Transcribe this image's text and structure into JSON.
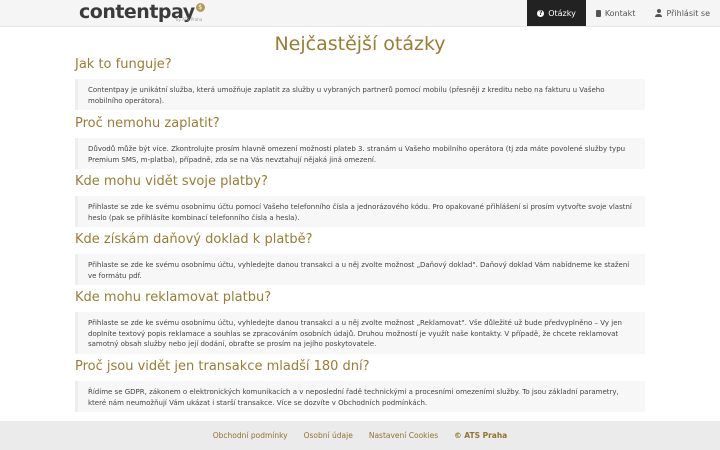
{
  "header": {
    "logo_text_main": "content",
    "logo_text_pay": "pay",
    "logo_sub": "by ATS Praha",
    "nav": [
      {
        "label": "Otázky",
        "icon": "question-icon",
        "active": true
      },
      {
        "label": "Kontakt",
        "icon": "book-icon",
        "active": false
      },
      {
        "label": "Přihlásit se",
        "icon": "user-icon",
        "active": false
      }
    ]
  },
  "main": {
    "title": "Nejčastější otázky",
    "faq": [
      {
        "question": "Jak to funguje?",
        "answer": "Contentpay je unikátní služba, která umožňuje zaplatit za služby u vybraných partnerů pomocí mobilu (přesněji z kreditu nebo na fakturu u Vašeho mobilního operátora)."
      },
      {
        "question": "Proč nemohu zaplatit?",
        "answer": "Důvodů může být více. Zkontrolujte prosím hlavně omezení možnosti plateb 3. stranám u Vašeho mobilního operátora (tj zda máte povolené služby typu Premium SMS, m-platba), případně, zda se na Vás nevztahují nějaká jiná omezení."
      },
      {
        "question": "Kde mohu vidět svoje platby?",
        "answer": "Přihlaste se zde ke svému osobnímu účtu pomocí Vašeho telefonního čísla a jednorázového kódu. Pro opakované přihlášení si prosím vytvořte svoje vlastní heslo (pak se přihlásíte kombinací telefonního čísla a hesla)."
      },
      {
        "question": "Kde získám daňový doklad k platbě?",
        "answer": "Přihlaste se zde ke svému osobnímu účtu, vyhledejte danou transakci a u něj zvolte možnost „Daňový doklad\". Daňový doklad Vám nabídneme ke stažení ve formátu pdf."
      },
      {
        "question": "Kde mohu reklamovat platbu?",
        "answer": "Přihlaste se zde ke svému osobnímu účtu, vyhledejte danou transakci a u něj zvolte možnost „Reklamovat\". Vše důležité už bude předvyplněno – Vy jen doplníte textový popis reklamace a souhlas se zpracováním osobních údajů. Druhou možností je využít naše kontakty. V případě, že chcete reklamovat samotný obsah služby nebo její dodání, obraťte se prosím na jejího poskytovatele."
      },
      {
        "question": "Proč jsou vidět jen transakce mladší 180 dní?",
        "answer": "Řídíme se GDPR, zákonem o elektronických komunikacích a v neposlední řadě technickými a procesními omezeními služby. To jsou základní parametry, které nám neumožňují Vám ukázat i starší transakce. Více se dozvíte v Obchodních podmínkách."
      }
    ]
  },
  "footer": {
    "links": [
      "Obchodní podmínky",
      "Osobní údaje",
      "Nastavení Cookies"
    ],
    "copyright": "© ATS Praha"
  },
  "colors": {
    "accent": "#9a7d35",
    "nav_active_bg": "#222222"
  }
}
